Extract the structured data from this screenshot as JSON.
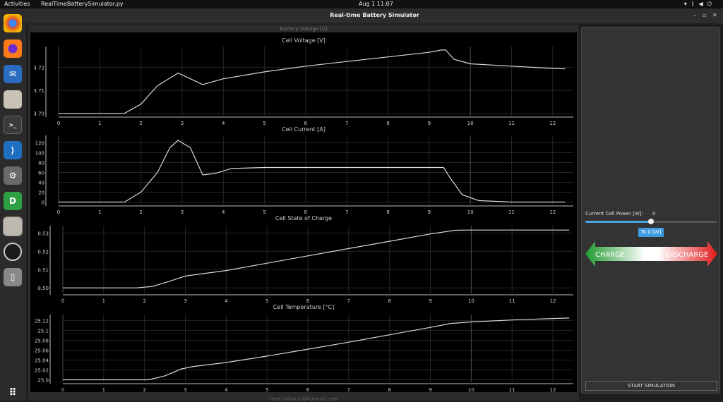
{
  "topbar": {
    "activities": "Activities",
    "app_name": "RealTimeBatterySimulator.py",
    "clock": "Aug 1  11:07"
  },
  "window": {
    "title": "Real-time Battery Simulator"
  },
  "plot_panel": {
    "header": "Battery Voltage [V]",
    "footer": "rene.radoicic@hotmail.com"
  },
  "side_panel": {
    "power_label": "Current Cell Power [W]:",
    "power_value": "0",
    "power_level": 0.5,
    "to_zero_button": "To 0 [W]",
    "charge_label": "CHARGE",
    "discharge_label": "DISCHARGE",
    "start_button": "START SIMULATION"
  },
  "colors": {
    "accent": "#4aa3e0",
    "charge": "#1e9a2e",
    "discharge": "#e01818",
    "trace": "#d8d8d8"
  },
  "chart_data": [
    {
      "type": "line",
      "title": "Cell Voltage [V]",
      "xlim": [
        0,
        12.5
      ],
      "ylim": [
        3.699,
        3.729
      ],
      "xticks": [
        "0",
        "1",
        "2",
        "3",
        "4",
        "5",
        "6",
        "7",
        "8",
        "9",
        "10",
        "11",
        "12"
      ],
      "yticks": [
        "3.70",
        "3.71",
        "3.72"
      ],
      "ytick_values": [
        3.7,
        3.71,
        3.72
      ],
      "series": [
        {
          "x": [
            0,
            1.6,
            2.0,
            2.4,
            2.9,
            3.2,
            3.5,
            4,
            5,
            6,
            7,
            8,
            9,
            9.3,
            9.4,
            9.6,
            10,
            11,
            12,
            12.3
          ],
          "y": [
            3.7,
            3.7,
            3.704,
            3.712,
            3.7175,
            3.715,
            3.7125,
            3.715,
            3.718,
            3.7205,
            3.7225,
            3.7245,
            3.7265,
            3.7275,
            3.7275,
            3.7235,
            3.7215,
            3.7205,
            3.7195,
            3.7193
          ]
        }
      ]
    },
    {
      "type": "line",
      "title": "Cell Current [A]",
      "xlim": [
        0,
        12.5
      ],
      "ylim": [
        -5,
        135
      ],
      "xticks": [
        "0",
        "1",
        "2",
        "3",
        "4",
        "5",
        "6",
        "7",
        "8",
        "9",
        "10",
        "11",
        "12"
      ],
      "yticks": [
        "0",
        "20",
        "40",
        "60",
        "80",
        "100",
        "120"
      ],
      "ytick_values": [
        0,
        20,
        40,
        60,
        80,
        100,
        120
      ],
      "series": [
        {
          "x": [
            0,
            1.6,
            2.0,
            2.4,
            2.7,
            2.9,
            3.2,
            3.5,
            3.8,
            4.2,
            5,
            6,
            7,
            8,
            9,
            9.35,
            9.5,
            9.8,
            10.2,
            11,
            12,
            12.3
          ],
          "y": [
            0,
            0,
            20,
            60,
            110,
            125,
            110,
            55,
            58,
            68,
            70,
            70,
            70,
            70,
            70,
            70,
            50,
            15,
            3,
            0,
            0,
            0
          ]
        }
      ]
    },
    {
      "type": "line",
      "title": "Cell State of Charge",
      "xlim": [
        0,
        12.5
      ],
      "ylim": [
        0.497,
        0.534
      ],
      "xticks": [
        "0",
        "1",
        "2",
        "3",
        "4",
        "5",
        "6",
        "7",
        "8",
        "9",
        "10",
        "11",
        "12"
      ],
      "yticks": [
        "0.50",
        "0.51",
        "0.52",
        "0.53"
      ],
      "ytick_values": [
        0.5,
        0.51,
        0.52,
        0.53
      ],
      "series": [
        {
          "x": [
            0,
            1.8,
            2.2,
            2.6,
            3,
            4,
            5,
            6,
            7,
            8,
            9,
            9.6,
            10,
            11,
            12,
            12.4
          ],
          "y": [
            0.5,
            0.5,
            0.5008,
            0.5035,
            0.5065,
            0.5095,
            0.5135,
            0.5175,
            0.5215,
            0.5255,
            0.5295,
            0.5315,
            0.5316,
            0.5316,
            0.5316,
            0.5316
          ]
        }
      ]
    },
    {
      "type": "line",
      "title": "Cell Temperature [°C]",
      "xlim": [
        0,
        12.5
      ],
      "ylim": [
        24.995,
        25.132
      ],
      "xticks": [
        "0",
        "1",
        "2",
        "3",
        "4",
        "5",
        "6",
        "7",
        "8",
        "9",
        "10",
        "11",
        "12"
      ],
      "yticks": [
        "25.0",
        "25.02",
        "25.04",
        "25.06",
        "25.08",
        "25.1",
        "25.12"
      ],
      "ytick_values": [
        25.0,
        25.02,
        25.04,
        25.06,
        25.08,
        25.1,
        25.12
      ],
      "series": [
        {
          "x": [
            0,
            2.1,
            2.5,
            2.9,
            3.2,
            4,
            5,
            6,
            7,
            8,
            9,
            9.5,
            10,
            11,
            12,
            12.4
          ],
          "y": [
            25.0,
            25.0,
            25.008,
            25.022,
            25.027,
            25.035,
            25.048,
            25.062,
            25.076,
            25.091,
            25.106,
            25.114,
            25.117,
            25.121,
            25.124,
            25.125
          ]
        }
      ]
    }
  ]
}
